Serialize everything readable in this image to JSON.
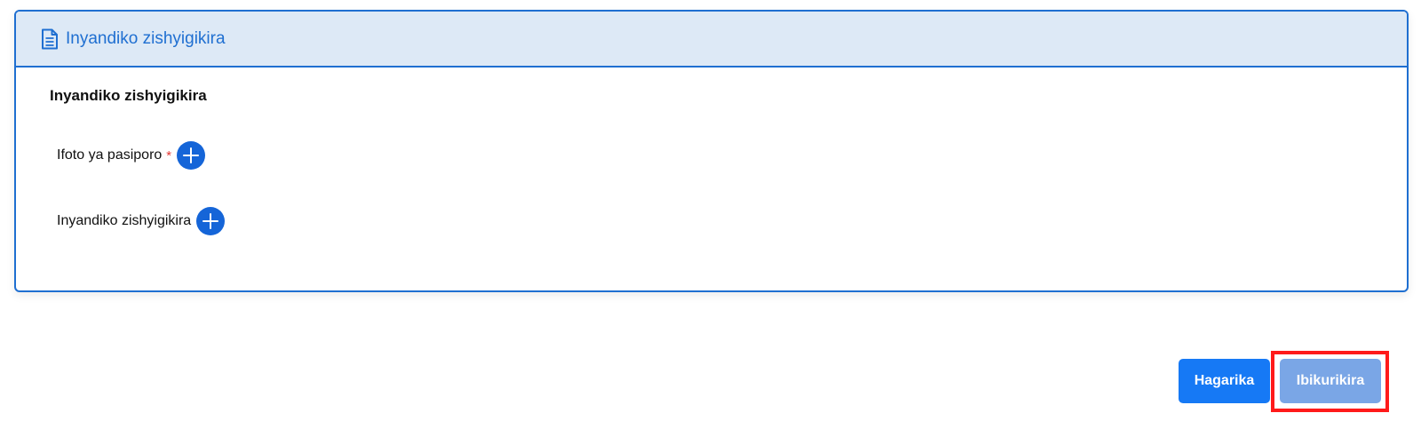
{
  "panel": {
    "header_icon": "document-icon",
    "title": "Inyandiko zishyigikira",
    "section_title": "Inyandiko zishyigikira",
    "uploads": [
      {
        "label": "Ifoto ya pasiporo",
        "required_mark": "*",
        "icon": "plus-circle-icon"
      },
      {
        "label": "Inyandiko zishyigikira",
        "icon": "plus-circle-icon"
      }
    ]
  },
  "actions": {
    "cancel_label": "Hagarika",
    "save_label": "Ibikurikira"
  },
  "colors": {
    "accent": "#1f6fd1",
    "header_bg": "#dde9f6",
    "primary_button": "#1679f5",
    "disabled_button": "#7aa6e6",
    "highlight": "#ff1a1a",
    "required": "#e53935"
  }
}
